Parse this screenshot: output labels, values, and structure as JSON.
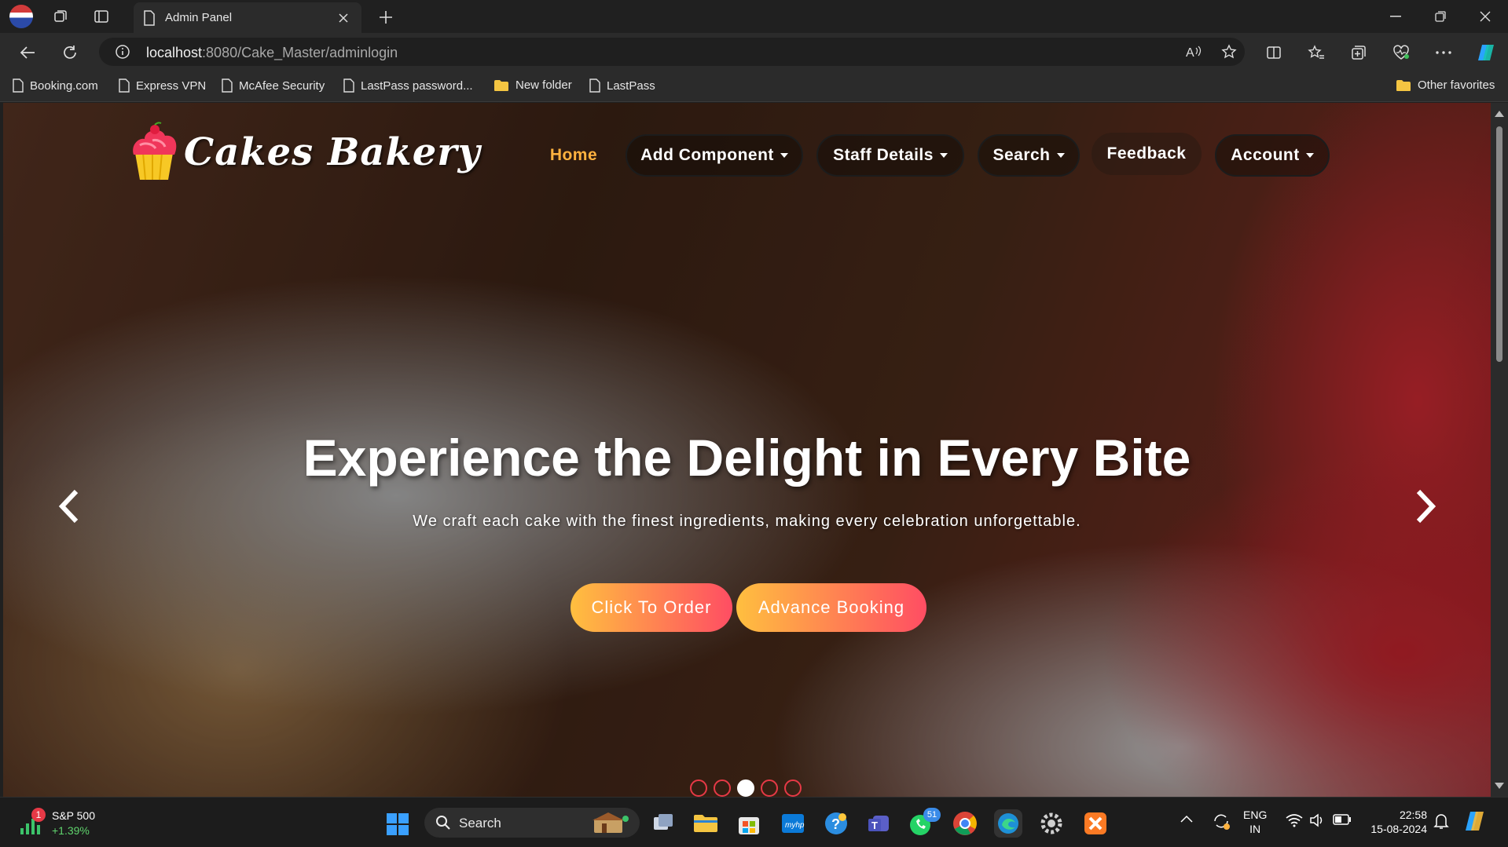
{
  "browser": {
    "tab_title": "Admin Panel",
    "url_host": "localhost",
    "url_rest": ":8080/Cake_Master/adminlogin",
    "favorites": [
      "Booking.com",
      "Express VPN",
      "McAfee Security",
      "LastPass password...",
      "New folder",
      "LastPass"
    ],
    "other_favorites": "Other favorites"
  },
  "site": {
    "brand": "Cakes Bakery",
    "menu": {
      "home": "Home",
      "add_component": "Add Component",
      "staff_details": "Staff Details",
      "search": "Search",
      "feedback": "Feedback",
      "account": "Account"
    },
    "hero": {
      "title": "Experience the Delight in Every Bite",
      "subtitle": "We craft each cake with the finest ingredients, making every celebration unforgettable.",
      "order_button": "Click To Order",
      "booking_button": "Advance Booking",
      "active_slide": 3,
      "slide_count": 5
    }
  },
  "taskbar": {
    "stock_name": "S&P 500",
    "stock_change": "+1.39%",
    "stock_badge": "1",
    "search_label": "Search",
    "whatsapp_badge": "51",
    "language_top": "ENG",
    "language_bottom": "IN",
    "time": "22:58",
    "date": "15-08-2024"
  },
  "colors": {
    "accent_orange": "#ffb23f",
    "cta_gradient_start": "#ffbf3f",
    "cta_gradient_end": "#ff4d63",
    "indicator_red": "#e63946"
  }
}
